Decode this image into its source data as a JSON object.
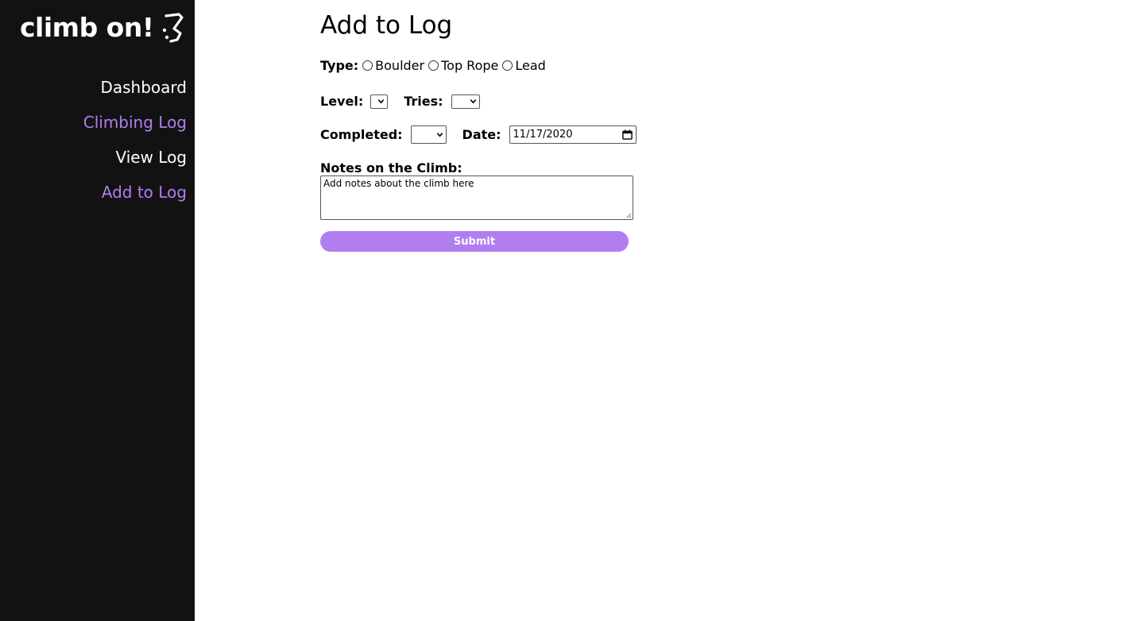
{
  "brand": {
    "name": "climb on!",
    "icon": "climbing-hold-icon"
  },
  "nav": {
    "items": [
      {
        "label": "Dashboard",
        "color": "#ffffff"
      },
      {
        "label": "Climbing Log",
        "color": "#b07ef0"
      },
      {
        "label": "View Log",
        "color": "#ffffff"
      },
      {
        "label": "Add to Log",
        "color": "#b07ef0"
      }
    ]
  },
  "page": {
    "title": "Add to Log"
  },
  "form": {
    "type_label": "Type:",
    "type_options": [
      "Boulder",
      "Top Rope",
      "Lead"
    ],
    "level_label": "Level:",
    "level_value": "",
    "tries_label": "Tries:",
    "tries_value": "",
    "completed_label": "Completed:",
    "completed_value": "",
    "date_label": "Date:",
    "date_value": "11/17/2020",
    "notes_label": "Notes on the Climb:",
    "notes_placeholder": "Add notes about the climb here",
    "submit_label": "Submit"
  },
  "colors": {
    "sidebar_bg": "#121212",
    "accent": "#b07ef0",
    "page_bg": "#ffffff"
  }
}
